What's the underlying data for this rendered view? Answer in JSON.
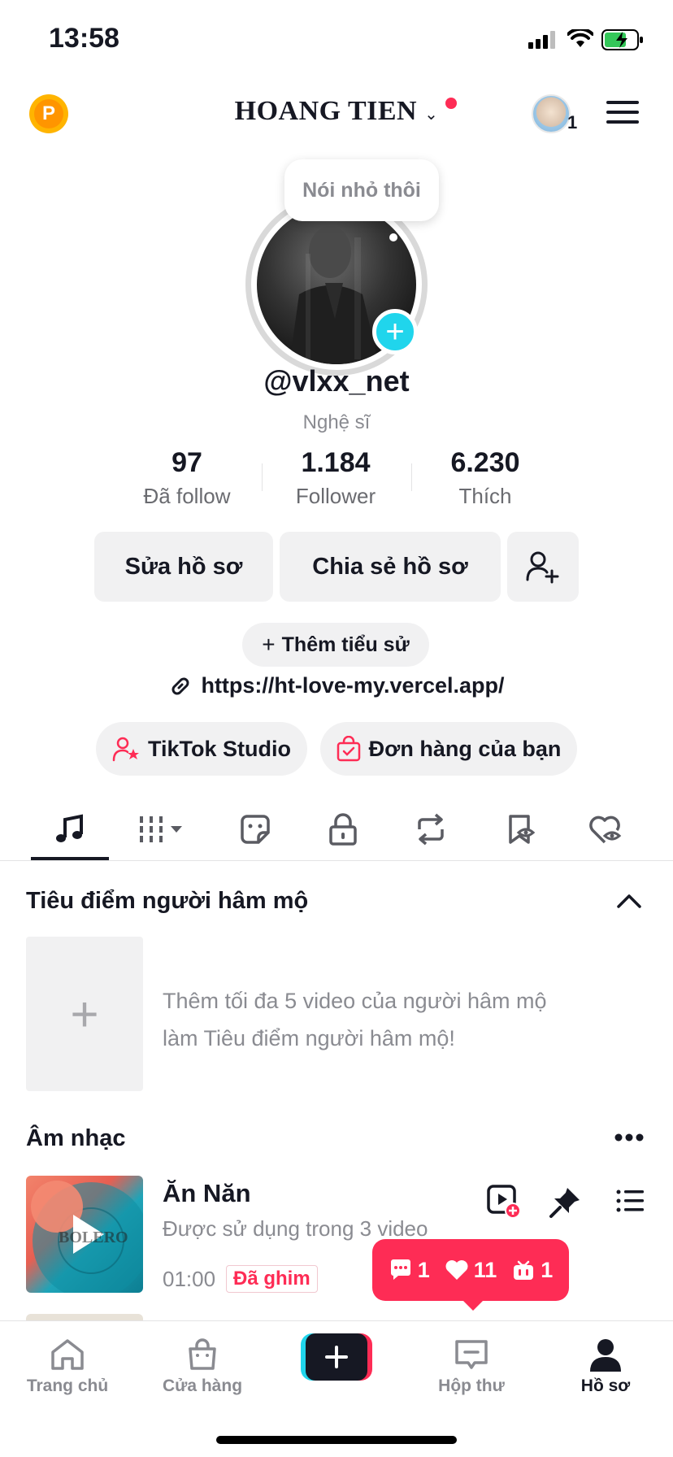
{
  "status_bar": {
    "time": "13:58"
  },
  "header": {
    "coin_label": "P",
    "username": "HOANG TIEN",
    "inbox_count": "1"
  },
  "profile": {
    "bubble_text": "Nói nhỏ thôi",
    "handle": "@vlxx_net",
    "role": "Nghệ sĩ",
    "stats": [
      {
        "value": "97",
        "label": "Đã follow"
      },
      {
        "value": "1.184",
        "label": "Follower"
      },
      {
        "value": "6.230",
        "label": "Thích"
      }
    ],
    "edit_button": "Sửa hồ sơ",
    "share_button": "Chia sẻ hồ sơ",
    "add_bio": "Thêm tiểu sử",
    "link": "https://ht-love-my.vercel.app/",
    "studio_chip": "TikTok Studio",
    "orders_chip": "Đơn hàng của bạn"
  },
  "fan_spotlight": {
    "title": "Tiêu điểm người hâm mộ",
    "empty_line1": "Thêm tối đa 5 video của người hâm mộ",
    "empty_line2": "làm Tiêu điểm người hâm mộ!"
  },
  "music": {
    "title": "Âm nhạc",
    "song_title": "Ăn Năn",
    "song_usage": "Được sử dụng trong 3 video",
    "duration": "01:00",
    "pinned": "Đã ghim",
    "thumb_text": "BOLERO"
  },
  "notification": {
    "comments": "1",
    "likes": "11",
    "followers": "1"
  },
  "bottom_nav": {
    "home": "Trang chủ",
    "shop": "Cửa hàng",
    "inbox": "Hộp thư",
    "profile": "Hồ sơ"
  },
  "colors": {
    "accent": "#fe2c55",
    "teal": "#20d5ec",
    "text": "#161823",
    "muted": "#8a8b91"
  }
}
